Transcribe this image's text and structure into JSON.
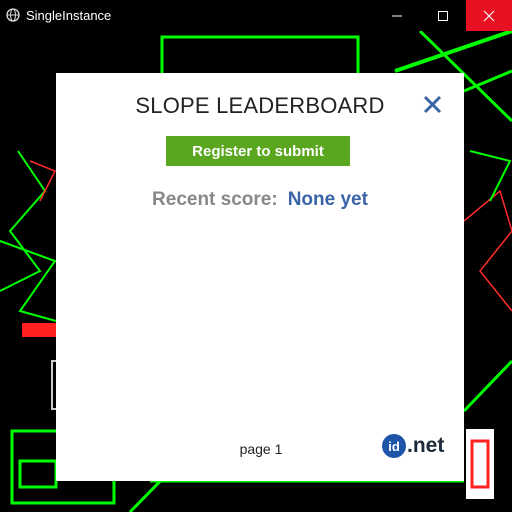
{
  "window": {
    "title": "SingleInstance",
    "controls": {
      "minimize_icon": "minimize-icon",
      "maximize_icon": "maximize-icon",
      "close_icon": "close-icon"
    }
  },
  "game_background": {
    "accent_color": "#00ff00",
    "warning_color": "#ff0000"
  },
  "leaderboard": {
    "title": "SLOPE LEADERBOARD",
    "register_label": "Register to submit",
    "recent_label": "Recent score:",
    "recent_value": "None yet",
    "page_label": "page 1",
    "logo_circle_text": "id",
    "logo_text": ".net",
    "colors": {
      "register_bg": "#5aa61f",
      "recent_value": "#3a64a8",
      "close": "#3a64a8"
    }
  }
}
